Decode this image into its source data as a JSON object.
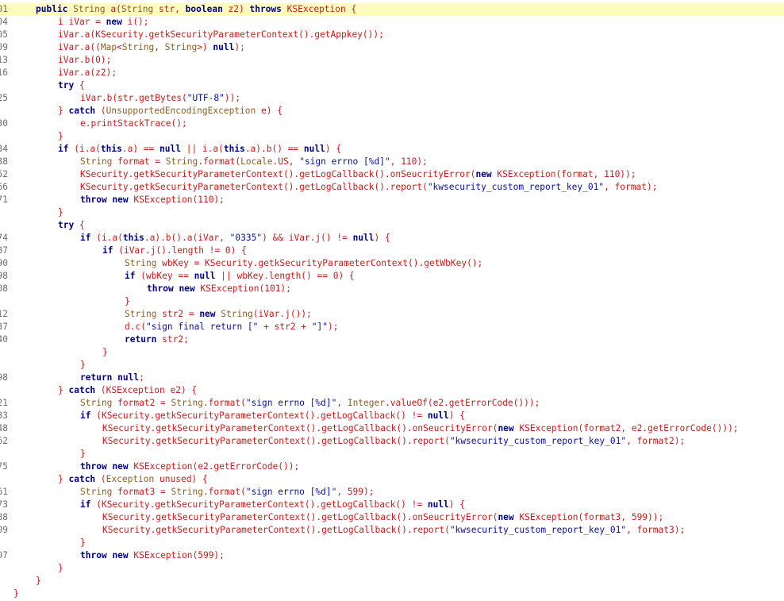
{
  "editor": {
    "colors": {
      "keyword": "#00008b",
      "type": "#8b5f21",
      "string": "#0b0fa6",
      "plain": "#000000",
      "punctuation": "#cc1b1b",
      "line_number": "#6d6d6d",
      "highlight_line": "#fefbbf",
      "background": "#ffffff"
    },
    "lines": [
      {
        "num": "01",
        "indent": 1,
        "hl": true,
        "tokens": [
          [
            "k",
            "public"
          ],
          [
            "p",
            " "
          ],
          [
            "t",
            "String"
          ],
          [
            "p",
            " a("
          ],
          [
            "t",
            "String"
          ],
          [
            "p",
            " str, "
          ],
          [
            "k",
            "boolean"
          ],
          [
            "p",
            " z2) "
          ],
          [
            "k",
            "throws"
          ],
          [
            "p",
            " KSException {"
          ]
        ]
      },
      {
        "num": "04",
        "indent": 2,
        "tokens": [
          [
            "p",
            "i iVar = "
          ],
          [
            "k",
            "new"
          ],
          [
            "p",
            " i();"
          ]
        ]
      },
      {
        "num": "05",
        "indent": 2,
        "tokens": [
          [
            "p",
            "iVar.a(KSecurity.getkSecurityParameterContext().getAppkey());"
          ]
        ]
      },
      {
        "num": "09",
        "indent": 2,
        "tokens": [
          [
            "p",
            "iVar.a(("
          ],
          [
            "t",
            "Map"
          ],
          [
            "p",
            "<"
          ],
          [
            "t",
            "String"
          ],
          [
            "p",
            ", "
          ],
          [
            "t",
            "String"
          ],
          [
            "p",
            ">) "
          ],
          [
            "k",
            "null"
          ],
          [
            "p",
            ");"
          ]
        ]
      },
      {
        "num": "13",
        "indent": 2,
        "tokens": [
          [
            "p",
            "iVar.b(0);"
          ]
        ]
      },
      {
        "num": "16",
        "indent": 2,
        "tokens": [
          [
            "p",
            "iVar.a(z2);"
          ]
        ]
      },
      {
        "num": "",
        "indent": 2,
        "tokens": [
          [
            "k",
            "try"
          ],
          [
            "p",
            " {"
          ]
        ]
      },
      {
        "num": "25",
        "indent": 3,
        "tokens": [
          [
            "p",
            "iVar.b(str.getBytes("
          ],
          [
            "s",
            "\"UTF-8\""
          ],
          [
            "p",
            "));"
          ]
        ]
      },
      {
        "num": "",
        "indent": 2,
        "tokens": [
          [
            "p",
            "} "
          ],
          [
            "k",
            "catch"
          ],
          [
            "p",
            " ("
          ],
          [
            "t",
            "UnsupportedEncodingException"
          ],
          [
            "p",
            " e) {"
          ]
        ]
      },
      {
        "num": "30",
        "indent": 3,
        "tokens": [
          [
            "p",
            "e.printStackTrace();"
          ]
        ]
      },
      {
        "num": "",
        "indent": 2,
        "tokens": [
          [
            "p",
            "}"
          ]
        ]
      },
      {
        "num": "34",
        "indent": 2,
        "tokens": [
          [
            "k",
            "if"
          ],
          [
            "p",
            " (i.a("
          ],
          [
            "k",
            "this"
          ],
          [
            "p",
            ".a) == "
          ],
          [
            "k",
            "null"
          ],
          [
            "p",
            " || i.a("
          ],
          [
            "k",
            "this"
          ],
          [
            "p",
            ".a).b() == "
          ],
          [
            "k",
            "null"
          ],
          [
            "p",
            ") {"
          ]
        ]
      },
      {
        "num": "38",
        "indent": 3,
        "tokens": [
          [
            "t",
            "String"
          ],
          [
            "p",
            " format = "
          ],
          [
            "t",
            "String"
          ],
          [
            "p",
            ".format("
          ],
          [
            "t",
            "Locale"
          ],
          [
            "p",
            ".US, "
          ],
          [
            "s",
            "\"sign errno [%d]\""
          ],
          [
            "p",
            ", 110);"
          ]
        ]
      },
      {
        "num": "52",
        "indent": 3,
        "tokens": [
          [
            "p",
            "KSecurity.getkSecurityParameterContext().getLogCallback().onSeucrityError("
          ],
          [
            "k",
            "new"
          ],
          [
            "p",
            " KSException(format, 110));"
          ]
        ]
      },
      {
        "num": "66",
        "indent": 3,
        "tokens": [
          [
            "p",
            "KSecurity.getkSecurityParameterContext().getLogCallback().report("
          ],
          [
            "s",
            "\"kwsecurity_custom_report_key_01\""
          ],
          [
            "p",
            ", format);"
          ]
        ]
      },
      {
        "num": "71",
        "indent": 3,
        "tokens": [
          [
            "k",
            "throw"
          ],
          [
            "p",
            " "
          ],
          [
            "k",
            "new"
          ],
          [
            "p",
            " KSException(110);"
          ]
        ]
      },
      {
        "num": "",
        "indent": 2,
        "tokens": [
          [
            "p",
            "}"
          ]
        ]
      },
      {
        "num": "",
        "indent": 2,
        "tokens": [
          [
            "k",
            "try"
          ],
          [
            "p",
            " {"
          ]
        ]
      },
      {
        "num": "74",
        "indent": 3,
        "tokens": [
          [
            "k",
            "if"
          ],
          [
            "p",
            " (i.a("
          ],
          [
            "k",
            "this"
          ],
          [
            "p",
            ".a).b().a(iVar, "
          ],
          [
            "s",
            "\"0335\""
          ],
          [
            "p",
            ") && iVar.j() != "
          ],
          [
            "k",
            "null"
          ],
          [
            "p",
            ") {"
          ]
        ]
      },
      {
        "num": "87",
        "indent": 4,
        "tokens": [
          [
            "k",
            "if"
          ],
          [
            "p",
            " (iVar.j().length != 0) {"
          ]
        ]
      },
      {
        "num": "90",
        "indent": 5,
        "tokens": [
          [
            "t",
            "String"
          ],
          [
            "p",
            " wbKey = KSecurity.getkSecurityParameterContext().getWbKey();"
          ]
        ]
      },
      {
        "num": "98",
        "indent": 5,
        "tokens": [
          [
            "k",
            "if"
          ],
          [
            "p",
            " (wbKey == "
          ],
          [
            "k",
            "null"
          ],
          [
            "p",
            " || wbKey.length() == 0) {"
          ]
        ]
      },
      {
        "num": "08",
        "indent": 6,
        "tokens": [
          [
            "k",
            "throw"
          ],
          [
            "p",
            " "
          ],
          [
            "k",
            "new"
          ],
          [
            "p",
            " KSException(101);"
          ]
        ]
      },
      {
        "num": "",
        "indent": 5,
        "tokens": [
          [
            "p",
            "}"
          ]
        ]
      },
      {
        "num": "12",
        "indent": 5,
        "tokens": [
          [
            "t",
            "String"
          ],
          [
            "p",
            " str2 = "
          ],
          [
            "k",
            "new"
          ],
          [
            "p",
            " "
          ],
          [
            "t",
            "String"
          ],
          [
            "p",
            "(iVar.j());"
          ]
        ]
      },
      {
        "num": "37",
        "indent": 5,
        "tokens": [
          [
            "p",
            "d.c("
          ],
          [
            "s",
            "\"sign final return [\""
          ],
          [
            "p",
            " + str2 + "
          ],
          [
            "s",
            "\"]\""
          ],
          [
            "p",
            ");"
          ]
        ]
      },
      {
        "num": "40",
        "indent": 5,
        "tokens": [
          [
            "k",
            "return"
          ],
          [
            "p",
            " str2;"
          ]
        ]
      },
      {
        "num": "",
        "indent": 4,
        "tokens": [
          [
            "p",
            "}"
          ]
        ]
      },
      {
        "num": "",
        "indent": 3,
        "tokens": [
          [
            "p",
            "}"
          ]
        ]
      },
      {
        "num": "98",
        "indent": 3,
        "tokens": [
          [
            "k",
            "return"
          ],
          [
            "p",
            " "
          ],
          [
            "k",
            "null"
          ],
          [
            "p",
            ";"
          ]
        ]
      },
      {
        "num": "",
        "indent": 2,
        "tokens": [
          [
            "p",
            "} "
          ],
          [
            "k",
            "catch"
          ],
          [
            "p",
            " (KSException e2) {"
          ]
        ]
      },
      {
        "num": "21",
        "indent": 3,
        "tokens": [
          [
            "t",
            "String"
          ],
          [
            "p",
            " format2 = "
          ],
          [
            "t",
            "String"
          ],
          [
            "p",
            ".format("
          ],
          [
            "s",
            "\"sign errno [%d]\""
          ],
          [
            "p",
            ", "
          ],
          [
            "t",
            "Integer"
          ],
          [
            "p",
            ".valueOf(e2.getErrorCode()));"
          ]
        ]
      },
      {
        "num": "33",
        "indent": 3,
        "tokens": [
          [
            "k",
            "if"
          ],
          [
            "p",
            " (KSecurity.getkSecurityParameterContext().getLogCallback() != "
          ],
          [
            "k",
            "null"
          ],
          [
            "p",
            ") {"
          ]
        ]
      },
      {
        "num": "48",
        "indent": 4,
        "tokens": [
          [
            "p",
            "KSecurity.getkSecurityParameterContext().getLogCallback().onSeucrityError("
          ],
          [
            "k",
            "new"
          ],
          [
            "p",
            " KSException(format2, e2.getErrorCode()));"
          ]
        ]
      },
      {
        "num": "62",
        "indent": 4,
        "tokens": [
          [
            "p",
            "KSecurity.getkSecurityParameterContext().getLogCallback().report("
          ],
          [
            "s",
            "\"kwsecurity_custom_report_key_01\""
          ],
          [
            "p",
            ", format2);"
          ]
        ]
      },
      {
        "num": "",
        "indent": 3,
        "tokens": [
          [
            "p",
            "}"
          ]
        ]
      },
      {
        "num": "75",
        "indent": 3,
        "tokens": [
          [
            "k",
            "throw"
          ],
          [
            "p",
            " "
          ],
          [
            "k",
            "new"
          ],
          [
            "p",
            " KSException(e2.getErrorCode());"
          ]
        ]
      },
      {
        "num": "",
        "indent": 2,
        "tokens": [
          [
            "p",
            "} "
          ],
          [
            "k",
            "catch"
          ],
          [
            "p",
            " ("
          ],
          [
            "t",
            "Exception"
          ],
          [
            "p",
            " unused) {"
          ]
        ]
      },
      {
        "num": "61",
        "indent": 3,
        "tokens": [
          [
            "t",
            "String"
          ],
          [
            "p",
            " format3 = "
          ],
          [
            "t",
            "String"
          ],
          [
            "p",
            ".format("
          ],
          [
            "s",
            "\"sign errno [%d]\""
          ],
          [
            "p",
            ", 599);"
          ]
        ]
      },
      {
        "num": "73",
        "indent": 3,
        "tokens": [
          [
            "k",
            "if"
          ],
          [
            "p",
            " (KSecurity.getkSecurityParameterContext().getLogCallback() != "
          ],
          [
            "k",
            "null"
          ],
          [
            "p",
            ") {"
          ]
        ]
      },
      {
        "num": "88",
        "indent": 4,
        "tokens": [
          [
            "p",
            "KSecurity.getkSecurityParameterContext().getLogCallback().onSeucrityError("
          ],
          [
            "k",
            "new"
          ],
          [
            "p",
            " KSException(format3, 599));"
          ]
        ]
      },
      {
        "num": "09",
        "indent": 4,
        "tokens": [
          [
            "p",
            "KSecurity.getkSecurityParameterContext().getLogCallback().report("
          ],
          [
            "s",
            "\"kwsecurity_custom_report_key_01\""
          ],
          [
            "p",
            ", format3);"
          ]
        ]
      },
      {
        "num": "",
        "indent": 3,
        "tokens": [
          [
            "p",
            "}"
          ]
        ]
      },
      {
        "num": "07",
        "indent": 3,
        "tokens": [
          [
            "k",
            "throw"
          ],
          [
            "p",
            " "
          ],
          [
            "k",
            "new"
          ],
          [
            "p",
            " KSException(599);"
          ]
        ]
      },
      {
        "num": "",
        "indent": 2,
        "tokens": [
          [
            "p",
            "}"
          ]
        ]
      },
      {
        "num": "",
        "indent": 1,
        "tokens": [
          [
            "p",
            "}"
          ]
        ]
      },
      {
        "num": "",
        "indent": 0,
        "tokens": [
          [
            "p",
            "}"
          ]
        ]
      }
    ]
  }
}
